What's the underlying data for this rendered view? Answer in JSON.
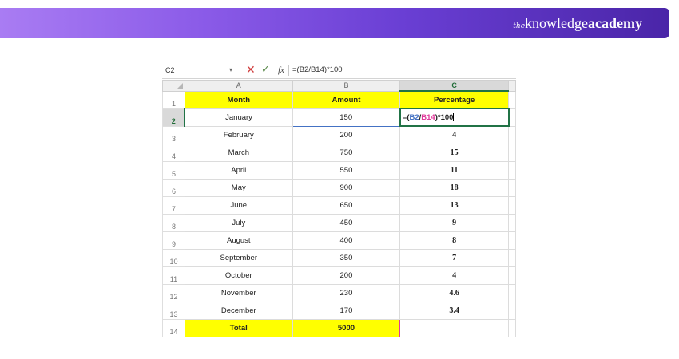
{
  "brand": {
    "the": "the",
    "knowledge": "knowledge",
    "academy": "academy"
  },
  "formula_bar": {
    "name_box": "C2",
    "cancel_symbol": "✕",
    "enter_symbol": "✓",
    "fx_label": "fx",
    "formula": "=(B2/B14)*100"
  },
  "columns": [
    "A",
    "B",
    "C"
  ],
  "headers": {
    "month": "Month",
    "amount": "Amount",
    "percentage": "Percentage"
  },
  "active_cell": {
    "eq": "=(",
    "ref1": "B2",
    "slash": "/",
    "ref2": "B14",
    "tail": ")*100"
  },
  "rows": [
    {
      "num": "1"
    },
    {
      "num": "2",
      "month": "January",
      "amount": "150"
    },
    {
      "num": "3",
      "month": "February",
      "amount": "200",
      "percentage": "4"
    },
    {
      "num": "4",
      "month": "March",
      "amount": "750",
      "percentage": "15"
    },
    {
      "num": "5",
      "month": "April",
      "amount": "550",
      "percentage": "11"
    },
    {
      "num": "6",
      "month": "May",
      "amount": "900",
      "percentage": "18"
    },
    {
      "num": "7",
      "month": "June",
      "amount": "650",
      "percentage": "13"
    },
    {
      "num": "8",
      "month": "July",
      "amount": "450",
      "percentage": "9"
    },
    {
      "num": "9",
      "month": "August",
      "amount": "400",
      "percentage": "8"
    },
    {
      "num": "10",
      "month": "September",
      "amount": "350",
      "percentage": "7"
    },
    {
      "num": "11",
      "month": "October",
      "amount": "200",
      "percentage": "4"
    },
    {
      "num": "12",
      "month": "November",
      "amount": "230",
      "percentage": "4.6"
    },
    {
      "num": "13",
      "month": "December",
      "amount": "170",
      "percentage": "3.4"
    },
    {
      "num": "14",
      "month": "Total",
      "amount": "5000",
      "percentage": ""
    }
  ],
  "colors": {
    "header_fill": "#ffff00",
    "selection": "#217346",
    "ref_blue": "#4472c4",
    "ref_pink": "#e0399b",
    "banner_start": "#a97cf3",
    "banner_end": "#4a25a8"
  }
}
